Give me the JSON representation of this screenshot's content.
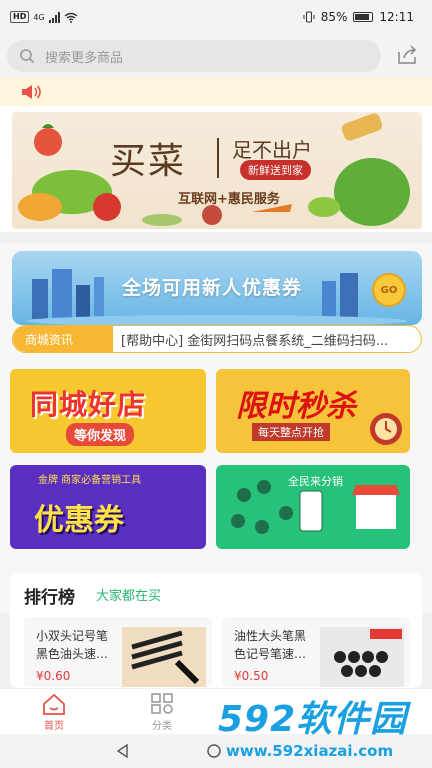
{
  "status_bar": {
    "time": "12:11",
    "battery": "85%",
    "hd": "HD",
    "net": "4G"
  },
  "search": {
    "placeholder": "搜索更多商品"
  },
  "banner": {
    "title": "买菜",
    "headline": "足不出户",
    "tagline": "新鲜送到家",
    "slogan": "互联网+惠民服务"
  },
  "coupon_banner": {
    "text": "全场可用新人优惠券",
    "coin": "GO"
  },
  "news": {
    "tag": "商城资讯",
    "item": "[帮助中心] 金街网扫码点餐系统_二维码扫码..."
  },
  "promo_cards": [
    {
      "title": "同城好店",
      "subtitle": "等你发现"
    },
    {
      "title": "限时秒杀",
      "subtitle": "每天整点开抢"
    },
    {
      "title": "优惠券",
      "badge": "金牌 商家必备营销工具"
    },
    {
      "title": "全民来分销"
    }
  ],
  "ranking": {
    "title": "排行榜",
    "subtitle": "大家都在买",
    "products": [
      {
        "name": "小双头记号笔黑色油头速…",
        "price": "¥0.60"
      },
      {
        "name": "油性大头笔黑色记号笔速…",
        "price": "¥0.50"
      }
    ]
  },
  "tabs": [
    {
      "label": "首页",
      "active": true
    },
    {
      "label": "分类",
      "active": false
    }
  ],
  "watermark": {
    "brand": "592软件园",
    "url": "www.592xiazai.com"
  },
  "colors": {
    "accent": "#e8524a",
    "green": "#2bb673",
    "price": "#e53935",
    "news_tag": "#f7b733"
  }
}
